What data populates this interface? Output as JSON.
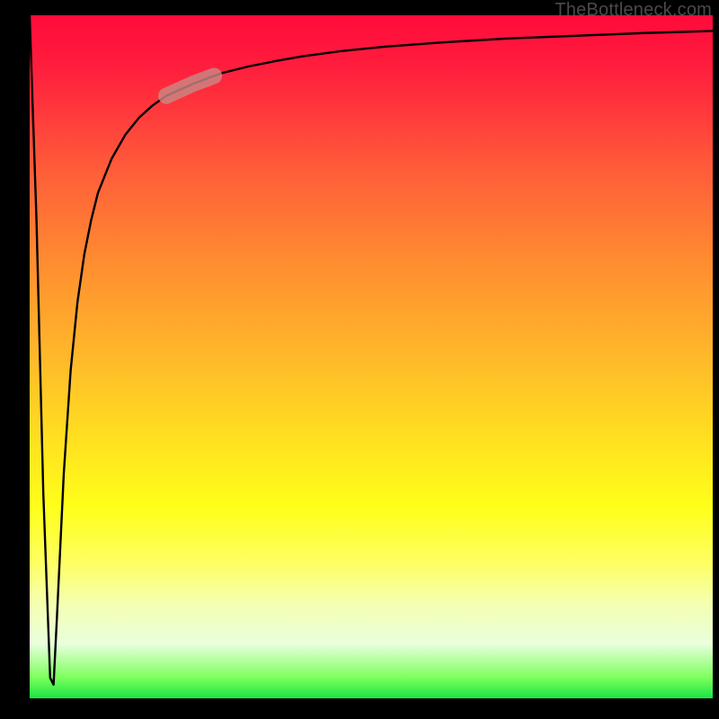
{
  "attribution": "TheBottleneck.com",
  "colors": {
    "frame": "#000000",
    "curve": "#000000",
    "highlight_fill": "#c88a85",
    "highlight_opacity": 0.8,
    "gradient_top": "#ff0a3a",
    "gradient_bottom": "#18e445"
  },
  "chart_data": {
    "type": "line",
    "title": "",
    "xlabel": "",
    "ylabel": "",
    "xlim": [
      0,
      100
    ],
    "ylim": [
      0,
      100
    ],
    "grid": false,
    "legend": false,
    "series": [
      {
        "name": "bottleneck-curve",
        "x": [
          0,
          1,
          2,
          3,
          3.5,
          4,
          5,
          6,
          7,
          8,
          9,
          10,
          12,
          14,
          16,
          18,
          20,
          24,
          28,
          32,
          36,
          40,
          46,
          52,
          60,
          70,
          80,
          90,
          100
        ],
        "y": [
          100,
          70,
          30,
          3,
          2,
          12,
          33,
          48,
          58,
          65,
          70,
          74,
          79,
          82.5,
          85,
          86.8,
          88.2,
          90,
          91.5,
          92.5,
          93.3,
          94,
          94.8,
          95.4,
          96,
          96.6,
          97,
          97.4,
          97.7
        ]
      }
    ],
    "annotations": [
      {
        "name": "highlight-segment",
        "x_range": [
          20,
          27
        ],
        "note": "short highlighted band along the curve"
      }
    ]
  }
}
